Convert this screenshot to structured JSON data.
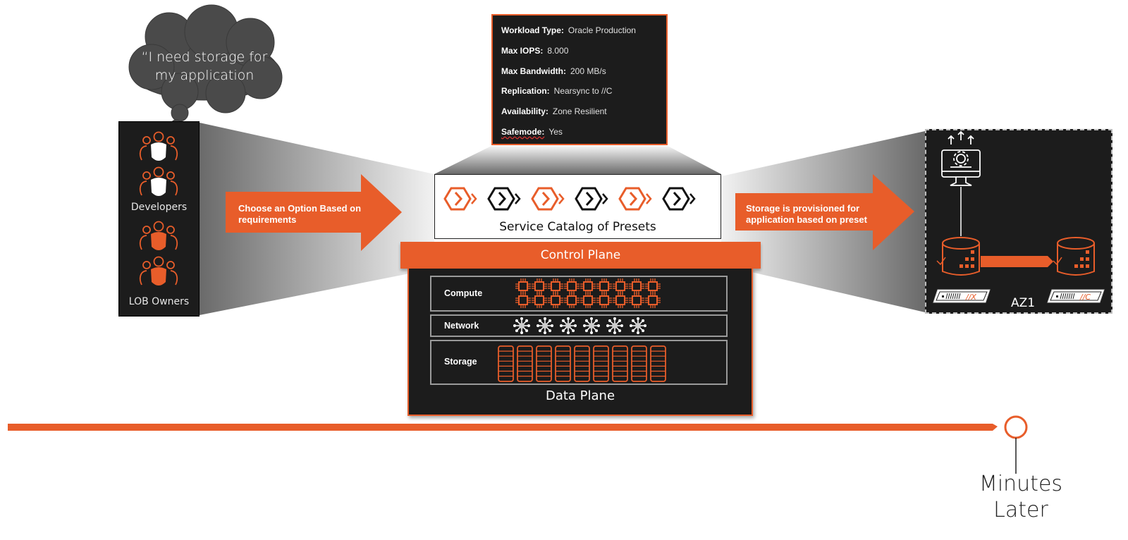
{
  "thought_bubble": {
    "line1": "“I need storage for",
    "line2": "my application"
  },
  "personas": [
    {
      "label": "Developers",
      "icon": "team-icon",
      "color": "#ffffff"
    },
    {
      "label": "LOB Owners",
      "icon": "team-icon",
      "color": "#e85d2a"
    }
  ],
  "left_arrow": {
    "line1": "Choose an Option Based on",
    "line2": "requirements"
  },
  "right_arrow": {
    "line1": "Storage is provisioned for",
    "line2": "application based on preset"
  },
  "preset_spec": [
    {
      "key": "Workload Type:",
      "value": "Oracle Production"
    },
    {
      "key": "Max IOPS:",
      "value": "8.000"
    },
    {
      "key": "Max Bandwidth:",
      "value": "200 MB/s"
    },
    {
      "key": "Replication:",
      "value": "Nearsync to //C"
    },
    {
      "key": "Availability:",
      "value": "Zone Resilient"
    },
    {
      "key": "Safemode:",
      "value": "Yes"
    }
  ],
  "service_catalog": {
    "title": "Service Catalog of Presets",
    "preset_icons": [
      "orange",
      "black",
      "orange",
      "black",
      "orange",
      "black"
    ]
  },
  "control_plane": {
    "label": "Control Plane"
  },
  "data_plane": {
    "title": "Data Plane",
    "rows": [
      {
        "label": "Compute",
        "icon": "cpu-chip-icon",
        "count": 18
      },
      {
        "label": "Network",
        "icon": "network-hub-icon",
        "count": 6
      },
      {
        "label": "Storage",
        "icon": "storage-rack-icon",
        "count": 9
      }
    ]
  },
  "availability_zone": {
    "label": "AZ1",
    "arrays": [
      {
        "badge": "//X"
      },
      {
        "badge": "//C"
      }
    ]
  },
  "timeline": {
    "label_line1": "Minutes",
    "label_line2": "Later"
  },
  "colors": {
    "accent": "#e85d2a",
    "panel": "#1c1c1c"
  }
}
